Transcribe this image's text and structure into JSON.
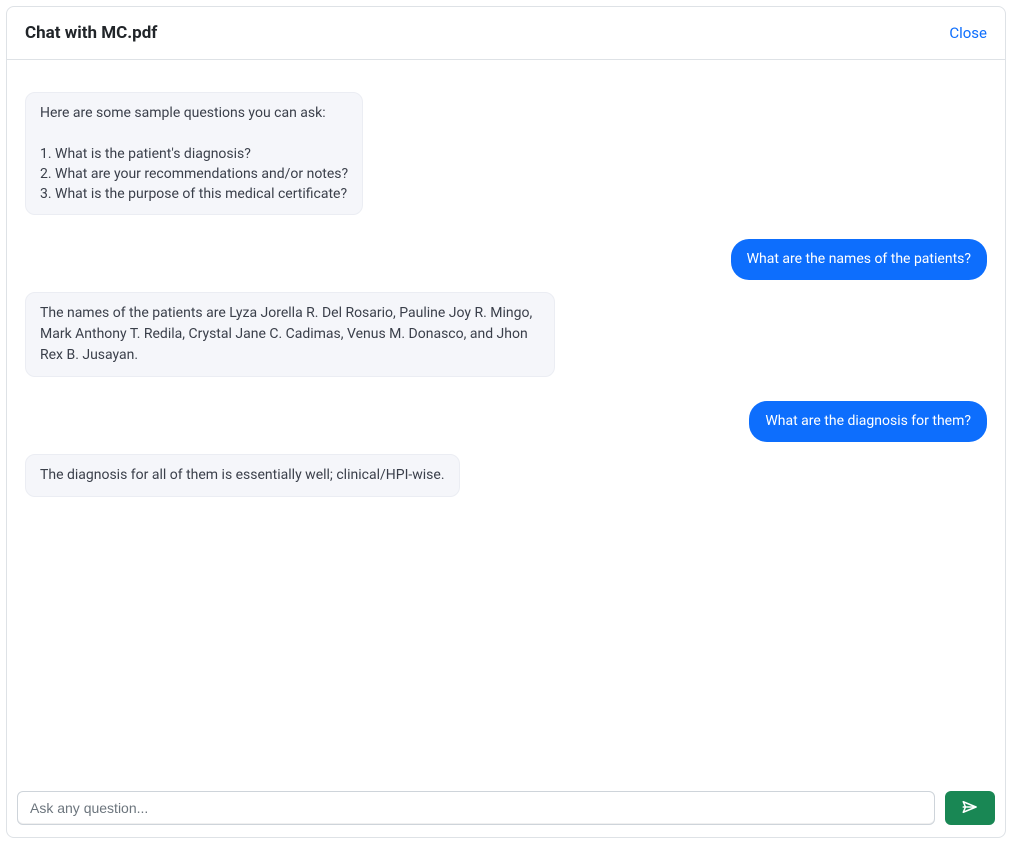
{
  "header": {
    "title": "Chat with MC.pdf",
    "close_label": "Close"
  },
  "messages": {
    "intro": "Here are some sample questions you can ask:\n\n1. What is the patient's diagnosis?\n2. What are your recommendations and/or notes?\n3. What is the purpose of this medical certificate?",
    "user_q1": "What are the names of the patients?",
    "bot_a1": "The names of the patients are Lyza Jorella R. Del Rosario, Pauline Joy R. Mingo, Mark Anthony T. Redila, Crystal Jane C. Cadimas, Venus M. Donasco, and Jhon Rex B. Jusayan.",
    "user_q2": "What are the diagnosis for them?",
    "bot_a2": "The diagnosis for all of them is essentially well; clinical/HPI-wise."
  },
  "input": {
    "placeholder": "Ask any question...",
    "value": ""
  },
  "colors": {
    "accent_blue": "#0d6efd",
    "send_green": "#198754",
    "bot_bg": "#f5f6fa"
  }
}
